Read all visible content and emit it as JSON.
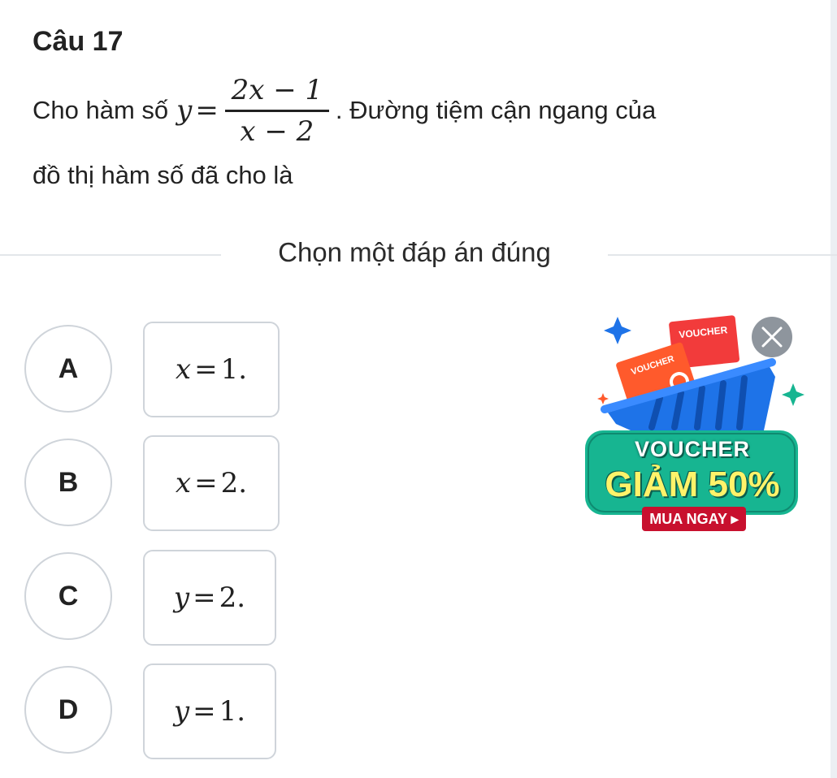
{
  "question": {
    "title": "Câu 17",
    "prefix": "Cho hàm số",
    "lhs": "y",
    "eq": "=",
    "numerator": "2x − 1",
    "denominator": "x − 2",
    "suffix": ". Đường tiệm cận ngang của",
    "line2": "đồ thị hàm số đã cho là"
  },
  "choose_label": "Chọn một đáp án đúng",
  "options": [
    {
      "letter": "A",
      "var": "x",
      "eq": "=",
      "value": "1",
      "end": "."
    },
    {
      "letter": "B",
      "var": "x",
      "eq": "=",
      "value": "2",
      "end": "."
    },
    {
      "letter": "C",
      "var": "y",
      "eq": "=",
      "value": "2",
      "end": "."
    },
    {
      "letter": "D",
      "var": "y",
      "eq": "=",
      "value": "1",
      "end": "."
    }
  ],
  "ad": {
    "tag1": "VOUCHER",
    "tag2": "VOUCHER",
    "title1": "VOUCHER",
    "title2": "GIẢM 50%",
    "cta": "MUA NGAY ▸",
    "close_icon": "close-icon",
    "colors": {
      "basket": "#1e73e8",
      "panel": "#17b591",
      "cta": "#c8102e",
      "voucher_orange": "#ff5a2c",
      "voucher_red": "#f23b3b"
    }
  }
}
